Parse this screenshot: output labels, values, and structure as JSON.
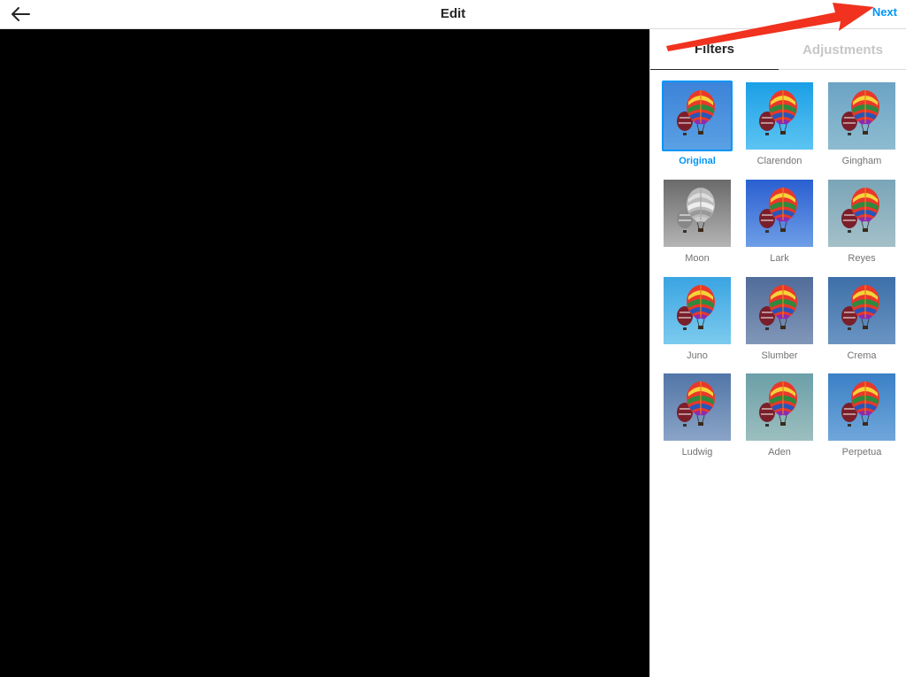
{
  "header": {
    "title": "Edit",
    "next_label": "Next",
    "back_icon": "back-arrow-icon"
  },
  "panel": {
    "tabs": [
      {
        "label": "Filters",
        "active": true
      },
      {
        "label": "Adjustments",
        "active": false
      }
    ],
    "filters": [
      {
        "label": "Original",
        "selected": true
      },
      {
        "label": "Clarendon",
        "selected": false
      },
      {
        "label": "Gingham",
        "selected": false
      },
      {
        "label": "Moon",
        "selected": false
      },
      {
        "label": "Lark",
        "selected": false
      },
      {
        "label": "Reyes",
        "selected": false
      },
      {
        "label": "Juno",
        "selected": false
      },
      {
        "label": "Slumber",
        "selected": false
      },
      {
        "label": "Crema",
        "selected": false
      },
      {
        "label": "Ludwig",
        "selected": false
      },
      {
        "label": "Aden",
        "selected": false
      },
      {
        "label": "Perpetua",
        "selected": false
      }
    ]
  },
  "colors": {
    "accent": "#0095f6",
    "annotation_arrow": "#f0321e",
    "preview_bg": "#000000"
  }
}
